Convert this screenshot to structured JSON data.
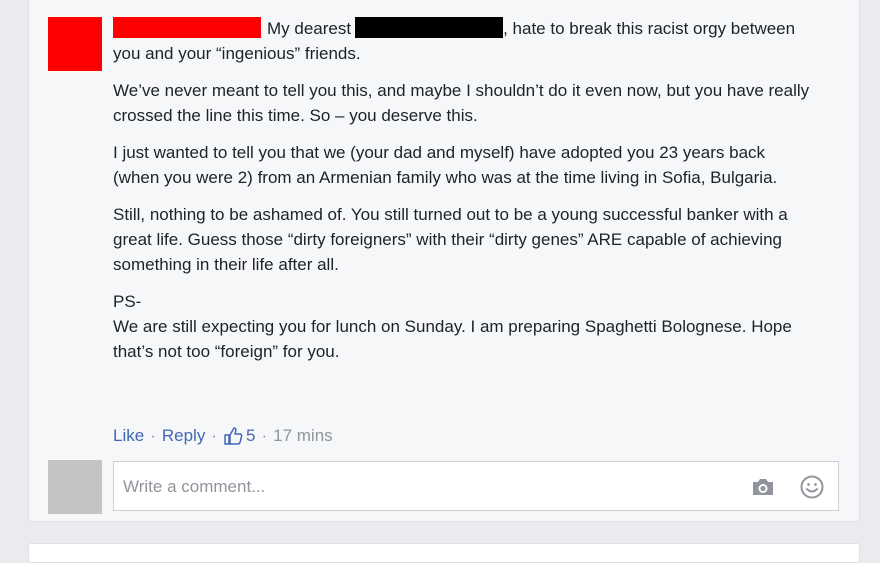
{
  "comment": {
    "greeting": "My dearest",
    "first_line_rest": ", hate to break this racist orgy between you and your “ingenious” friends.",
    "paragraphs": [
      "We’ve never meant to tell you this, and maybe I shouldn’t do it even now, but you have really crossed the line this time. So – you deserve this.",
      "I just wanted to tell you that we (your dad and myself) have adopted you 23 years back (when you were 2) from an Armenian family who was at the time living in Sofia, Bulgaria.",
      "Still, nothing to be ashamed of. You still turned out to be a young successful banker with a great life. Guess those “dirty foreigners” with their “dirty genes” ARE capable of achieving something in their life after all."
    ],
    "ps_label": "PS-",
    "ps_text": "We are still expecting you for lunch on Sunday. I am preparing Spaghetti Bolognese. Hope that’s not too “foreign” for you."
  },
  "actions": {
    "like_label": "Like",
    "separator": "·",
    "reply_label": "Reply",
    "like_count": "5",
    "time": "17 mins"
  },
  "reply_box": {
    "placeholder": "Write a comment..."
  },
  "icons": {
    "like": "thumbs-up-icon",
    "camera": "camera-icon",
    "emoji": "smiley-icon"
  },
  "colors": {
    "redaction_red": "#ff0000",
    "redaction_black": "#000000",
    "link_blue": "#4267b2"
  }
}
